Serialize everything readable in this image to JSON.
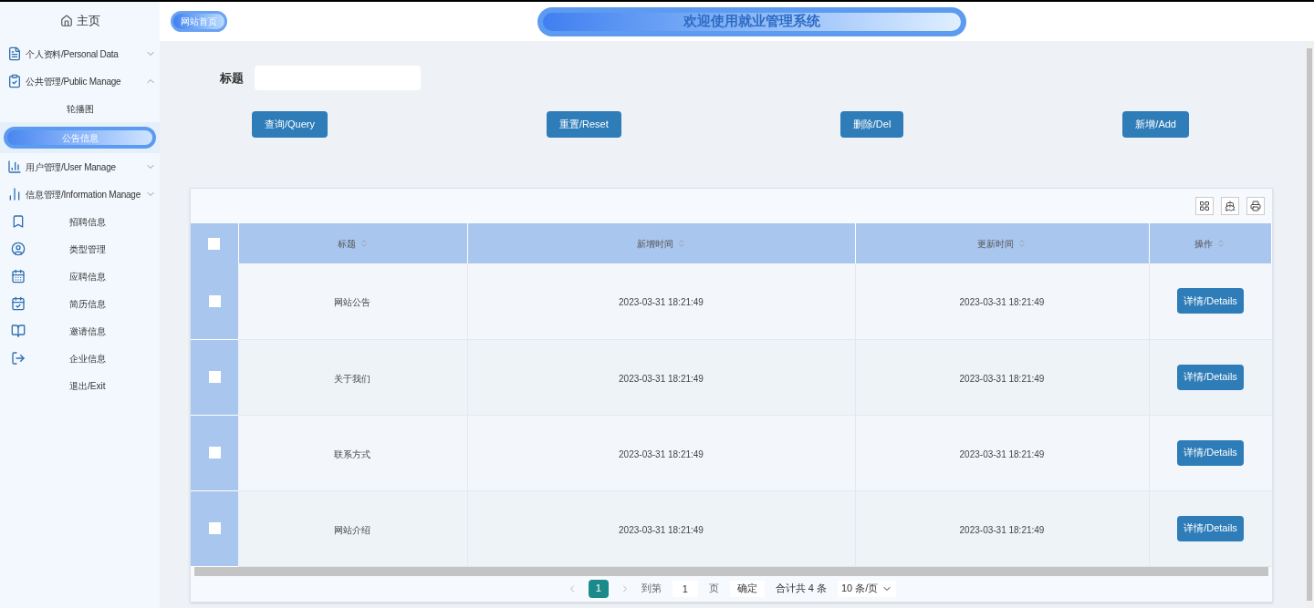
{
  "sidebar": {
    "home": "主页",
    "items": [
      {
        "kind": "group",
        "label": "个人资料/Personal Data",
        "expanded": false
      },
      {
        "kind": "group",
        "label": "公共管理/Public Manage",
        "expanded": true
      },
      {
        "kind": "sub",
        "label": "轮播图",
        "selected": false
      },
      {
        "kind": "sub",
        "label": "公告信息",
        "selected": true
      },
      {
        "kind": "group",
        "label": "用户管理/User Manage",
        "expanded": false
      },
      {
        "kind": "group",
        "label": "信息管理/Information Manage",
        "expanded": false
      },
      {
        "kind": "link",
        "label": "招聘信息"
      },
      {
        "kind": "link",
        "label": "类型管理"
      },
      {
        "kind": "link",
        "label": "应聘信息"
      },
      {
        "kind": "link",
        "label": "简历信息"
      },
      {
        "kind": "link",
        "label": "邀请信息"
      },
      {
        "kind": "link",
        "label": "企业信息"
      },
      {
        "kind": "link",
        "label": "退出/Exit"
      }
    ]
  },
  "header": {
    "home_link": "网站首页",
    "banner": "欢迎使用就业管理系统"
  },
  "search": {
    "label": "标题"
  },
  "buttons": [
    "查询/Query",
    "重置/Reset",
    "删除/Del",
    "新增/Add"
  ],
  "table": {
    "select_all_checked": false,
    "columns": [
      "标题",
      "新增时间",
      "更新时间",
      "操作"
    ],
    "rows": [
      {
        "checked": false,
        "title": "网站公告",
        "created": "2023-03-31 18:21:49",
        "updated": "2023-03-31 18:21:49",
        "action": "详情/Details"
      },
      {
        "checked": false,
        "title": "关于我们",
        "created": "2023-03-31 18:21:49",
        "updated": "2023-03-31 18:21:49",
        "action": "详情/Details"
      },
      {
        "checked": false,
        "title": "联系方式",
        "created": "2023-03-31 18:21:49",
        "updated": "2023-03-31 18:21:49",
        "action": "详情/Details"
      },
      {
        "checked": false,
        "title": "网站介绍",
        "created": "2023-03-31 18:21:49",
        "updated": "2023-03-31 18:21:49",
        "action": "详情/Details"
      }
    ]
  },
  "pagination": {
    "pages": [
      {
        "label": "1",
        "selected": true
      }
    ],
    "goto_label": "到第",
    "goto_value": "1",
    "page_unit": "页",
    "confirm": "确定",
    "total": "合计共 4 条",
    "page_size": "10 条/页"
  }
}
